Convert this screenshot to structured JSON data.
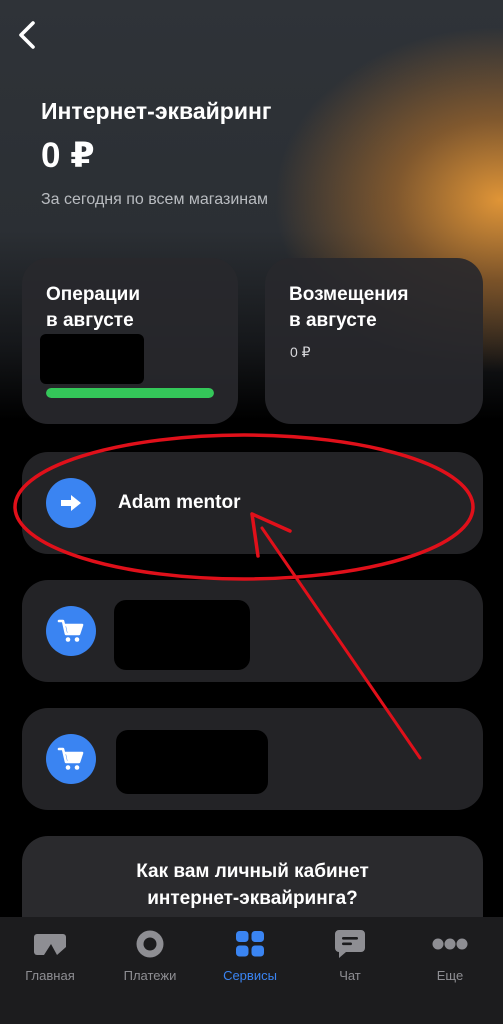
{
  "header": {
    "back_icon": "chevron-left-icon",
    "title": "Интернет-эквайринг",
    "amount": "0 ₽",
    "subtitle": "За сегодня по всем магазинам"
  },
  "cards": {
    "operations": {
      "title_line1": "Операции",
      "title_line2": "в августе",
      "progress": 1.0,
      "progress_color": "#34c759"
    },
    "refunds": {
      "title_line1": "Возмещения",
      "title_line2": "в августе",
      "value": "0 ₽"
    }
  },
  "stores": [
    {
      "label": "Adam mentor",
      "icon": "arrow-right-icon"
    },
    {
      "label": "",
      "icon": "cart-icon"
    },
    {
      "label": "",
      "icon": "cart-icon"
    }
  ],
  "survey": {
    "line1": "Как вам личный кабинет",
    "line2": "интернет-эквайринга?"
  },
  "tabbar": {
    "tabs": [
      {
        "label": "Главная",
        "icon": "home-card-icon",
        "active": false
      },
      {
        "label": "Платежи",
        "icon": "payments-circle-icon",
        "active": false
      },
      {
        "label": "Сервисы",
        "icon": "services-grid-icon",
        "active": true
      },
      {
        "label": "Чат",
        "icon": "chat-bubble-icon",
        "active": false
      },
      {
        "label": "Еще",
        "icon": "more-dots-icon",
        "active": false
      }
    ]
  },
  "colors": {
    "accent": "#3a84f2",
    "success": "#34c759",
    "annotation": "#e0101a"
  }
}
